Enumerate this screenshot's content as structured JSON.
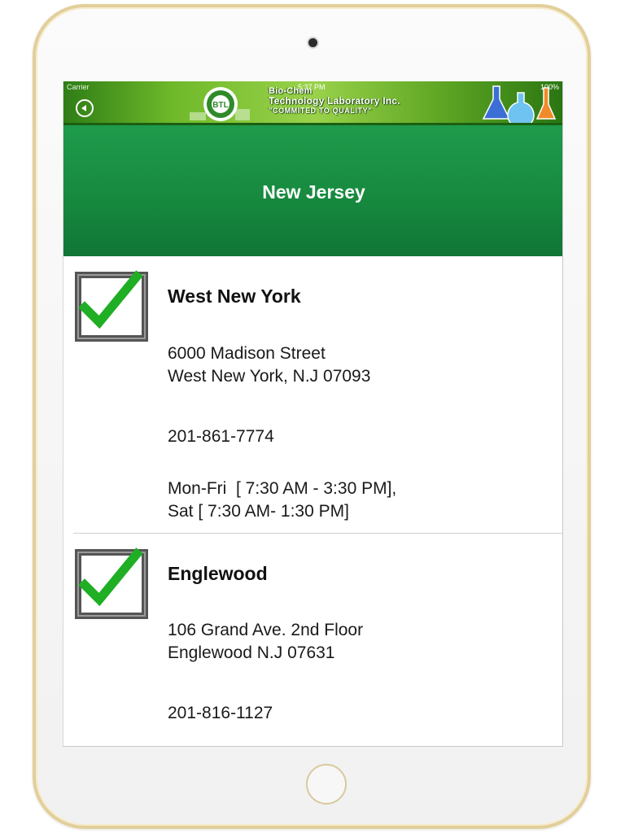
{
  "status_bar": {
    "carrier": "Carrier",
    "time": "5:37 PM",
    "battery": "100%"
  },
  "banner": {
    "line1": "Bio-Chem",
    "line2": "Technology Laboratory Inc.",
    "line3": "\"COMMITED TO QUALITY\"",
    "logo_text": "BTL"
  },
  "header": {
    "title": "New Jersey"
  },
  "locations": [
    {
      "name": "West New York",
      "address_line1": "6000 Madison Street",
      "address_line2": "West New York, N.J 07093",
      "phone": "201-861-7774",
      "hours_line1": "Mon-Fri  [ 7:30 AM - 3:30 PM],",
      "hours_line2": "Sat [ 7:30 AM- 1:30 PM]"
    },
    {
      "name": "Englewood",
      "address_line1": "106 Grand Ave. 2nd Floor",
      "address_line2": "Englewood N.J 07631",
      "phone": "201-816-1127"
    }
  ],
  "colors": {
    "header_green": "#178a3f",
    "banner_green": "#6fb92a",
    "checkmark_green": "#1fae24"
  },
  "icons": [
    "back-arrow-icon",
    "checkmark-icon",
    "flask-icon",
    "wifi-icon",
    "battery-icon"
  ]
}
